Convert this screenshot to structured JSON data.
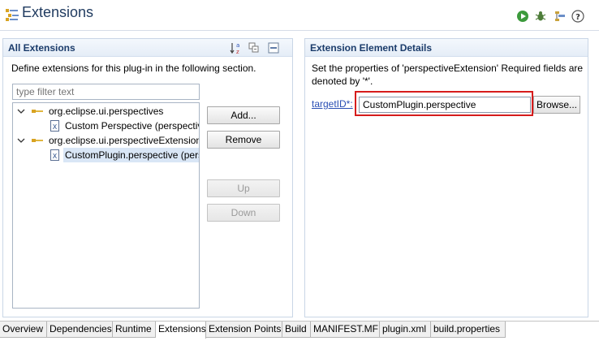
{
  "header": {
    "title": "Extensions",
    "icons": [
      "extensions-icon",
      "run-icon",
      "debug-icon",
      "export-icon",
      "help-icon"
    ]
  },
  "all_extensions": {
    "title": "All Extensions",
    "description": "Define extensions for this plug-in in the following section.",
    "filter_placeholder": "type filter text",
    "toolbar_icons": [
      "sort-alphabetically-icon",
      "collapse-icon",
      "minimize-icon"
    ],
    "tree": [
      {
        "label": "org.eclipse.ui.perspectives",
        "type": "extension-point",
        "expanded": true
      },
      {
        "label": "Custom Perspective (perspectiv",
        "type": "element",
        "selected": false
      },
      {
        "label": "org.eclipse.ui.perspectiveExtensions",
        "type": "extension-point",
        "expanded": true
      },
      {
        "label": "CustomPlugin.perspective (pers",
        "type": "element",
        "selected": true
      }
    ],
    "buttons": {
      "add": "Add...",
      "remove": "Remove",
      "up": "Up",
      "down": "Down"
    }
  },
  "details": {
    "title": "Extension Element Details",
    "description_line1": "Set the properties of 'perspectiveExtension' Required fields are",
    "description_line2": "denoted by '*'.",
    "field_label": "targetID*:",
    "field_value": "CustomPlugin.perspective",
    "browse": "Browse..."
  },
  "tabs": [
    {
      "label": "Overview",
      "active": false
    },
    {
      "label": "Dependencies",
      "active": false
    },
    {
      "label": "Runtime",
      "active": false
    },
    {
      "label": "Extensions",
      "active": true
    },
    {
      "label": "Extension Points",
      "active": false
    },
    {
      "label": "Build",
      "active": false
    },
    {
      "label": "MANIFEST.MF",
      "active": false
    },
    {
      "label": "plugin.xml",
      "active": false
    },
    {
      "label": "build.properties",
      "active": false
    }
  ]
}
